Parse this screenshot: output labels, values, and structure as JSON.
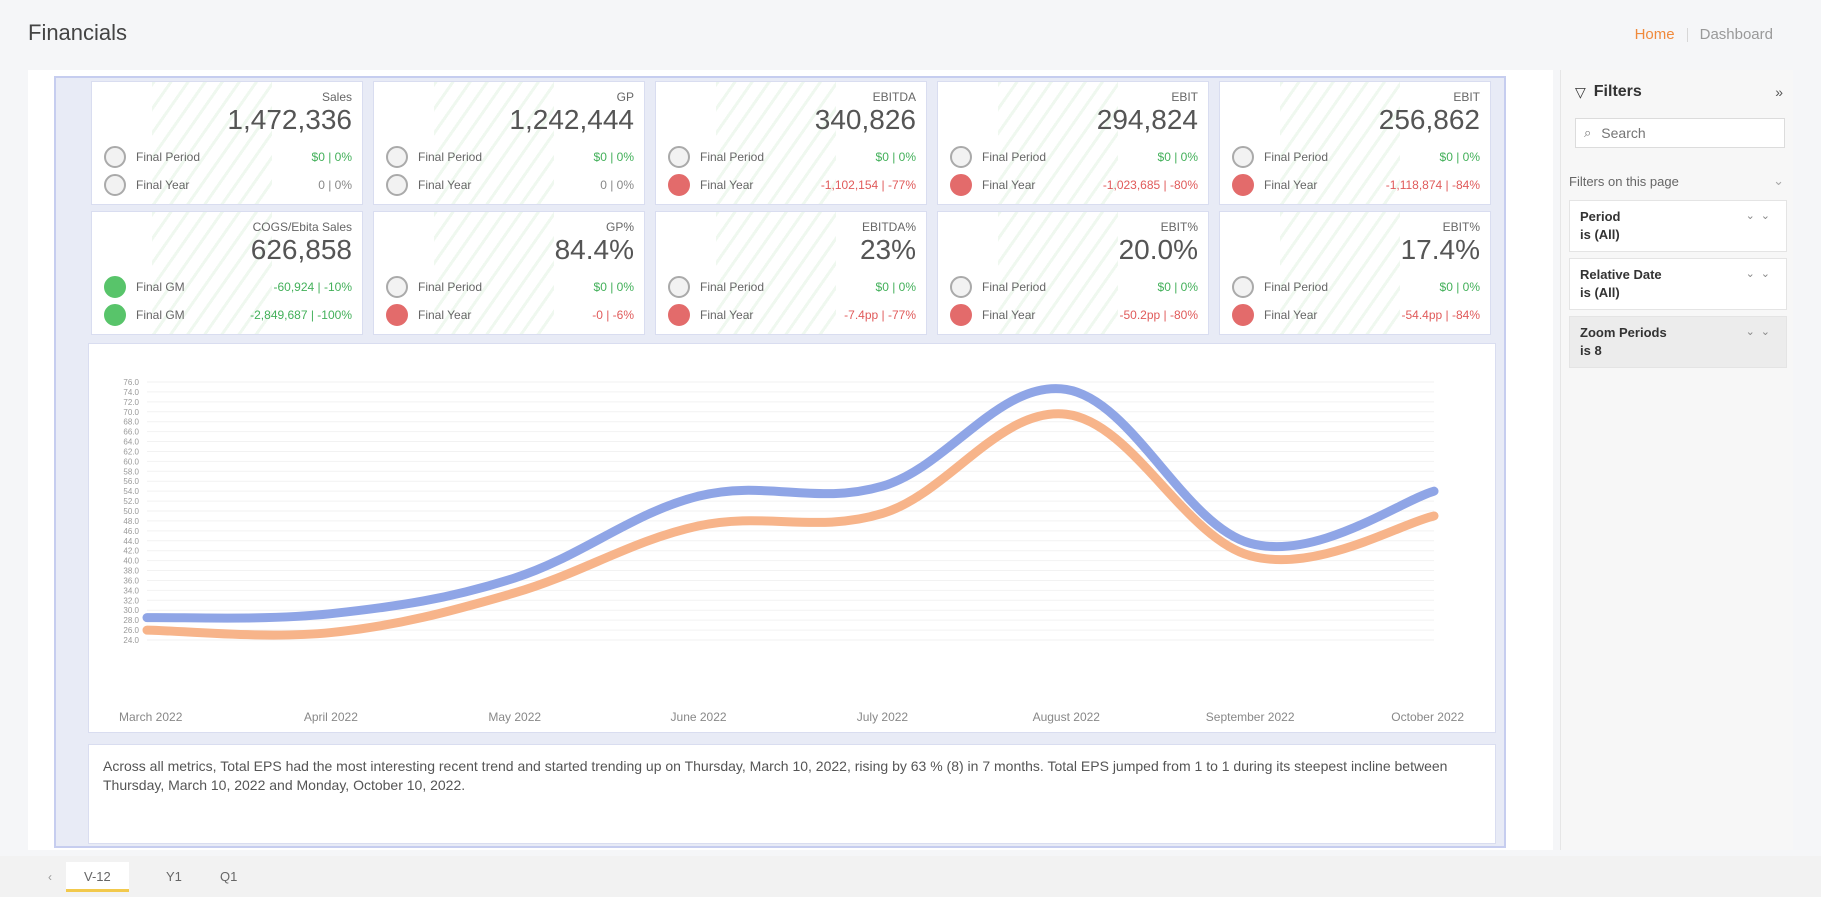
{
  "app": {
    "title": "Financials"
  },
  "nav": {
    "home": "Home",
    "dashboard": "Dashboard"
  },
  "kpis": [
    {
      "title": "Sales",
      "value": "1,472,336",
      "rows": [
        {
          "label": "Final Period",
          "value": "$0 | 0%",
          "status": "green",
          "icon": "neutral"
        },
        {
          "label": "Final Year",
          "value": "0 | 0%",
          "status": "neutral",
          "icon": "neutral"
        }
      ]
    },
    {
      "title": "GP",
      "value": "1,242,444",
      "rows": [
        {
          "label": "Final Period",
          "value": "$0 | 0%",
          "status": "green",
          "icon": "neutral"
        },
        {
          "label": "Final Year",
          "value": "0 | 0%",
          "status": "neutral",
          "icon": "neutral"
        }
      ]
    },
    {
      "title": "EBITDA",
      "value": "340,826",
      "rows": [
        {
          "label": "Final Period",
          "value": "$0 | 0%",
          "status": "green",
          "icon": "neutral"
        },
        {
          "label": "Final Year",
          "value": "-1,102,154 | -77%",
          "status": "red",
          "icon": "red"
        }
      ]
    },
    {
      "title": "EBIT",
      "value": "294,824",
      "rows": [
        {
          "label": "Final Period",
          "value": "$0 | 0%",
          "status": "green",
          "icon": "neutral"
        },
        {
          "label": "Final Year",
          "value": "-1,023,685 | -80%",
          "status": "red",
          "icon": "red"
        }
      ]
    },
    {
      "title": "EBIT",
      "value": "256,862",
      "rows": [
        {
          "label": "Final Period",
          "value": "$0 | 0%",
          "status": "green",
          "icon": "neutral"
        },
        {
          "label": "Final Year",
          "value": "-1,118,874 | -84%",
          "status": "red",
          "icon": "red"
        }
      ]
    },
    {
      "title": "COGS/Ebita Sales",
      "value": "626,858",
      "rows": [
        {
          "label": "Final GM",
          "value": "-60,924 | -10%",
          "status": "green",
          "icon": "green"
        },
        {
          "label": "Final GM",
          "value": "-2,849,687 | -100%",
          "status": "green",
          "icon": "green"
        }
      ]
    },
    {
      "title": "GP%",
      "value": "84.4%",
      "rows": [
        {
          "label": "Final Period",
          "value": "$0 | 0%",
          "status": "green",
          "icon": "neutral"
        },
        {
          "label": "Final Year",
          "value": "-0 | -6%",
          "status": "red",
          "icon": "red"
        }
      ]
    },
    {
      "title": "EBITDA%",
      "value": "23%",
      "rows": [
        {
          "label": "Final Period",
          "value": "$0 | 0%",
          "status": "green",
          "icon": "neutral"
        },
        {
          "label": "Final Year",
          "value": "-7.4pp | -77%",
          "status": "red",
          "icon": "red"
        }
      ]
    },
    {
      "title": "EBIT%",
      "value": "20.0%",
      "rows": [
        {
          "label": "Final Period",
          "value": "$0 | 0%",
          "status": "green",
          "icon": "neutral"
        },
        {
          "label": "Final Year",
          "value": "-50.2pp | -80%",
          "status": "red",
          "icon": "red"
        }
      ]
    },
    {
      "title": "EBIT%",
      "value": "17.4%",
      "rows": [
        {
          "label": "Final Period",
          "value": "$0 | 0%",
          "status": "green",
          "icon": "neutral"
        },
        {
          "label": "Final Year",
          "value": "-54.4pp | -84%",
          "status": "red",
          "icon": "red"
        }
      ]
    }
  ],
  "colors": {
    "series_blue": "#8fa5e6",
    "series_orange": "#f7b48a",
    "green": "#58c46a",
    "red": "#e36b6b",
    "accent": "#f08a3c"
  },
  "chart_data": {
    "type": "line",
    "x": [
      "March 2022",
      "April 2022",
      "May 2022",
      "June 2022",
      "July 2022",
      "August 2022",
      "September 2022",
      "October 2022"
    ],
    "series": [
      {
        "color": "#8fa5e6",
        "values": [
          28.5,
          29.3,
          36.5,
          53,
          55,
          74.5,
          43.5,
          54
        ]
      },
      {
        "color": "#f7b48a",
        "values": [
          26,
          25.5,
          33.5,
          47,
          49.5,
          69.5,
          41,
          49
        ]
      }
    ],
    "y_ticks": [
      "24.0",
      "26.0",
      "28.0",
      "30.0",
      "32.0",
      "34.0",
      "36.0",
      "38.0",
      "40.0",
      "42.0",
      "44.0",
      "46.0",
      "48.0",
      "50.0",
      "52.0",
      "54.0",
      "56.0",
      "58.0",
      "60.0",
      "62.0",
      "64.0",
      "66.0",
      "68.0",
      "70.0",
      "72.0",
      "74.0",
      "76.0"
    ],
    "ylim": [
      24,
      76
    ],
    "grid": true
  },
  "narrative": "Across all metrics, Total EPS had the most interesting recent trend and started trending up on Thursday, March 10, 2022, rising by 63 % (8) in 7 months. Total EPS jumped from 1 to 1 during its steepest incline between Thursday, March 10, 2022 and Monday, October 10, 2022.",
  "filters": {
    "title": "Filters",
    "search_placeholder": "Search",
    "section": "Filters on this page",
    "items": [
      {
        "name": "Period",
        "value": "is (All)"
      },
      {
        "name": "Relative Date",
        "value": "is (All)"
      },
      {
        "name": "Zoom Periods",
        "value": "is 8"
      }
    ]
  },
  "tabs": [
    "V-12",
    "Y1",
    "Q1"
  ]
}
